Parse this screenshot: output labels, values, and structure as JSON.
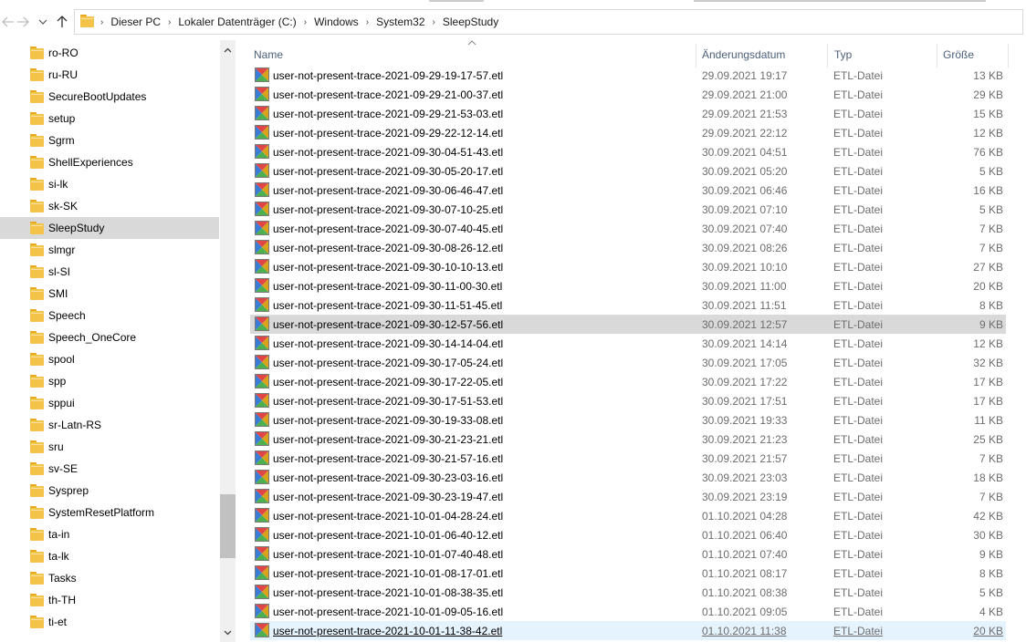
{
  "navigation": {
    "back_icon": "arrow-left-icon",
    "forward_icon": "arrow-right-icon",
    "recent_icon": "chevron-down-icon",
    "up_icon": "arrow-up-icon"
  },
  "address_bar": {
    "breadcrumbs": [
      "Dieser PC",
      "Lokaler Datenträger (C:)",
      "Windows",
      "System32",
      "SleepStudy"
    ]
  },
  "tree": {
    "items": [
      {
        "label": "ro-RO"
      },
      {
        "label": "ru-RU"
      },
      {
        "label": "SecureBootUpdates"
      },
      {
        "label": "setup"
      },
      {
        "label": "Sgrm"
      },
      {
        "label": "ShellExperiences"
      },
      {
        "label": "si-lk"
      },
      {
        "label": "sk-SK"
      },
      {
        "label": "SleepStudy",
        "selected": true
      },
      {
        "label": "slmgr"
      },
      {
        "label": "sl-SI"
      },
      {
        "label": "SMI"
      },
      {
        "label": "Speech"
      },
      {
        "label": "Speech_OneCore"
      },
      {
        "label": "spool"
      },
      {
        "label": "spp"
      },
      {
        "label": "sppui"
      },
      {
        "label": "sr-Latn-RS"
      },
      {
        "label": "sru"
      },
      {
        "label": "sv-SE"
      },
      {
        "label": "Sysprep"
      },
      {
        "label": "SystemResetPlatform"
      },
      {
        "label": "ta-in"
      },
      {
        "label": "ta-lk"
      },
      {
        "label": "Tasks"
      },
      {
        "label": "th-TH"
      },
      {
        "label": "ti-et"
      }
    ]
  },
  "file_list": {
    "columns": {
      "name": "Name",
      "date": "Änderungsdatum",
      "type": "Typ",
      "size": "Größe"
    },
    "rows": [
      {
        "name": "user-not-present-trace-2021-09-29-19-17-57.etl",
        "date": "29.09.2021 19:17",
        "type": "ETL-Datei",
        "size": "13 KB"
      },
      {
        "name": "user-not-present-trace-2021-09-29-21-00-37.etl",
        "date": "29.09.2021 21:00",
        "type": "ETL-Datei",
        "size": "29 KB"
      },
      {
        "name": "user-not-present-trace-2021-09-29-21-53-03.etl",
        "date": "29.09.2021 21:53",
        "type": "ETL-Datei",
        "size": "15 KB"
      },
      {
        "name": "user-not-present-trace-2021-09-29-22-12-14.etl",
        "date": "29.09.2021 22:12",
        "type": "ETL-Datei",
        "size": "12 KB"
      },
      {
        "name": "user-not-present-trace-2021-09-30-04-51-43.etl",
        "date": "30.09.2021 04:51",
        "type": "ETL-Datei",
        "size": "76 KB"
      },
      {
        "name": "user-not-present-trace-2021-09-30-05-20-17.etl",
        "date": "30.09.2021 05:20",
        "type": "ETL-Datei",
        "size": "5 KB"
      },
      {
        "name": "user-not-present-trace-2021-09-30-06-46-47.etl",
        "date": "30.09.2021 06:46",
        "type": "ETL-Datei",
        "size": "16 KB"
      },
      {
        "name": "user-not-present-trace-2021-09-30-07-10-25.etl",
        "date": "30.09.2021 07:10",
        "type": "ETL-Datei",
        "size": "5 KB"
      },
      {
        "name": "user-not-present-trace-2021-09-30-07-40-45.etl",
        "date": "30.09.2021 07:40",
        "type": "ETL-Datei",
        "size": "7 KB"
      },
      {
        "name": "user-not-present-trace-2021-09-30-08-26-12.etl",
        "date": "30.09.2021 08:26",
        "type": "ETL-Datei",
        "size": "7 KB"
      },
      {
        "name": "user-not-present-trace-2021-09-30-10-10-13.etl",
        "date": "30.09.2021 10:10",
        "type": "ETL-Datei",
        "size": "27 KB"
      },
      {
        "name": "user-not-present-trace-2021-09-30-11-00-30.etl",
        "date": "30.09.2021 11:00",
        "type": "ETL-Datei",
        "size": "20 KB"
      },
      {
        "name": "user-not-present-trace-2021-09-30-11-51-45.etl",
        "date": "30.09.2021 11:51",
        "type": "ETL-Datei",
        "size": "8 KB"
      },
      {
        "name": "user-not-present-trace-2021-09-30-12-57-56.etl",
        "date": "30.09.2021 12:57",
        "type": "ETL-Datei",
        "size": "9 KB",
        "highlighted": true
      },
      {
        "name": "user-not-present-trace-2021-09-30-14-14-04.etl",
        "date": "30.09.2021 14:14",
        "type": "ETL-Datei",
        "size": "12 KB"
      },
      {
        "name": "user-not-present-trace-2021-09-30-17-05-24.etl",
        "date": "30.09.2021 17:05",
        "type": "ETL-Datei",
        "size": "32 KB"
      },
      {
        "name": "user-not-present-trace-2021-09-30-17-22-05.etl",
        "date": "30.09.2021 17:22",
        "type": "ETL-Datei",
        "size": "17 KB"
      },
      {
        "name": "user-not-present-trace-2021-09-30-17-51-53.etl",
        "date": "30.09.2021 17:51",
        "type": "ETL-Datei",
        "size": "17 KB"
      },
      {
        "name": "user-not-present-trace-2021-09-30-19-33-08.etl",
        "date": "30.09.2021 19:33",
        "type": "ETL-Datei",
        "size": "11 KB"
      },
      {
        "name": "user-not-present-trace-2021-09-30-21-23-21.etl",
        "date": "30.09.2021 21:23",
        "type": "ETL-Datei",
        "size": "25 KB"
      },
      {
        "name": "user-not-present-trace-2021-09-30-21-57-16.etl",
        "date": "30.09.2021 21:57",
        "type": "ETL-Datei",
        "size": "7 KB"
      },
      {
        "name": "user-not-present-trace-2021-09-30-23-03-16.etl",
        "date": "30.09.2021 23:03",
        "type": "ETL-Datei",
        "size": "18 KB"
      },
      {
        "name": "user-not-present-trace-2021-09-30-23-19-47.etl",
        "date": "30.09.2021 23:19",
        "type": "ETL-Datei",
        "size": "7 KB"
      },
      {
        "name": "user-not-present-trace-2021-10-01-04-28-24.etl",
        "date": "01.10.2021 04:28",
        "type": "ETL-Datei",
        "size": "42 KB"
      },
      {
        "name": "user-not-present-trace-2021-10-01-06-40-12.etl",
        "date": "01.10.2021 06:40",
        "type": "ETL-Datei",
        "size": "30 KB"
      },
      {
        "name": "user-not-present-trace-2021-10-01-07-40-48.etl",
        "date": "01.10.2021 07:40",
        "type": "ETL-Datei",
        "size": "9 KB"
      },
      {
        "name": "user-not-present-trace-2021-10-01-08-17-01.etl",
        "date": "01.10.2021 08:17",
        "type": "ETL-Datei",
        "size": "8 KB"
      },
      {
        "name": "user-not-present-trace-2021-10-01-08-38-35.etl",
        "date": "01.10.2021 08:38",
        "type": "ETL-Datei",
        "size": "5 KB"
      },
      {
        "name": "user-not-present-trace-2021-10-01-09-05-16.etl",
        "date": "01.10.2021 09:05",
        "type": "ETL-Datei",
        "size": "4 KB"
      },
      {
        "name": "user-not-present-trace-2021-10-01-11-38-42.etl",
        "date": "01.10.2021 11:38",
        "type": "ETL-Datei",
        "size": "20 KB",
        "focused": true
      }
    ]
  },
  "colors": {
    "folder": "#f4c34a",
    "selection": "#d9d9d9",
    "focus_row": "#e5f3ff",
    "header_text": "#4c607a",
    "secondary_text": "#6d6d6d"
  }
}
